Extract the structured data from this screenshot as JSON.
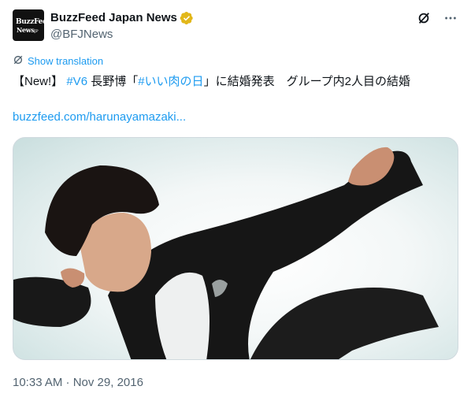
{
  "account": {
    "display_name": "BuzzFeed Japan News",
    "handle": "@BFJNews",
    "avatar_logo": {
      "line1": "BuzzFeed",
      "line2": "News",
      "line2_suffix": "JP"
    },
    "verified_color": "#e2b719"
  },
  "actions": {
    "grok_icon": "grok-icon",
    "more_icon": "more-icon"
  },
  "translation": {
    "label": "Show translation",
    "icon": "translate-icon"
  },
  "tweet": {
    "prefix": "【New!】 ",
    "hashtag1": "#V6",
    "part2": " 長野博「",
    "hashtag2": "#いい肉の日",
    "part3": "」に結婚発表　グループ内2人目の結婚",
    "link": "buzzfeed.com/harunayamazaki..."
  },
  "media": {
    "description_icon": "photo-image"
  },
  "timestamp": "10:33 AM · Nov 29, 2016",
  "colors": {
    "accent": "#1d9bf0",
    "muted": "#536471",
    "text": "#0f1419"
  }
}
